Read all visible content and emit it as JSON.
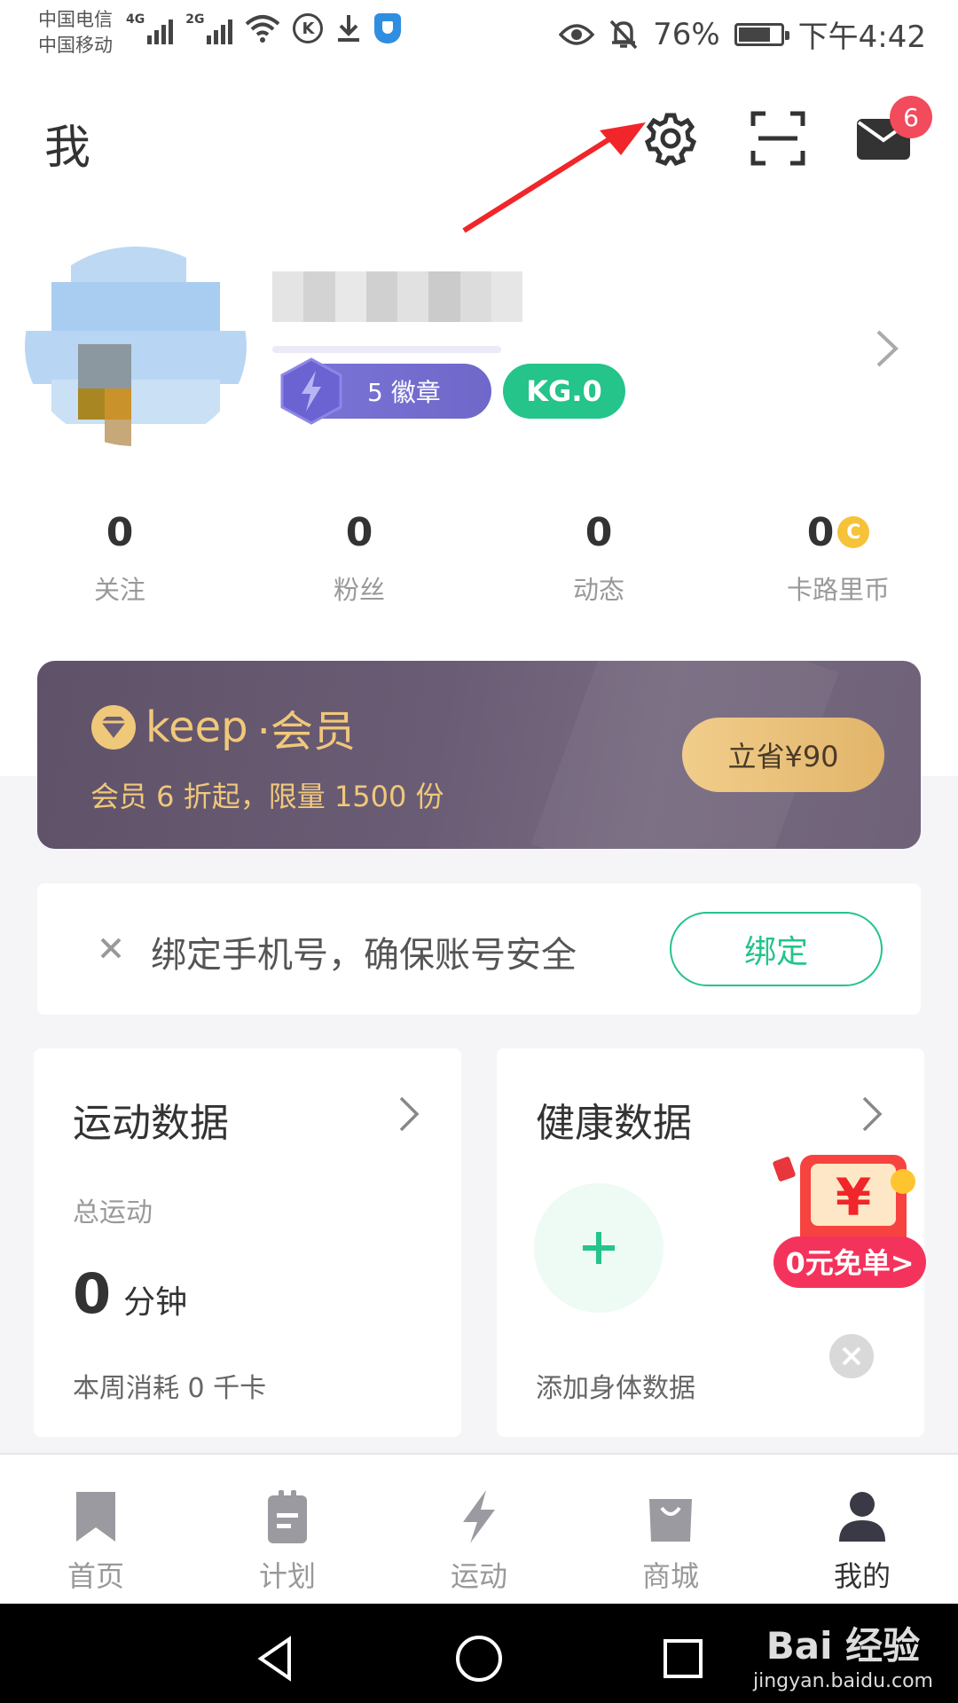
{
  "status_bar": {
    "carrier_1": "中国电信",
    "carrier_2": "中国移动",
    "net_1": "4G",
    "net_2": "2G",
    "k_icon_letter": "K",
    "battery_percent": "76%",
    "battery_level": 0.76,
    "time": "下午4:42"
  },
  "header": {
    "title": "我",
    "mail_badge_count": "6"
  },
  "profile": {
    "badge_count_label": "5 徽章",
    "kg_level": "KG.0"
  },
  "stats": [
    {
      "value": "0",
      "label": "关注"
    },
    {
      "value": "0",
      "label": "粉丝"
    },
    {
      "value": "0",
      "label": "动态"
    },
    {
      "value": "0",
      "label": "卡路里币",
      "coin_glyph": "C"
    }
  ],
  "vip_banner": {
    "brand": "keep",
    "brand_suffix": "·会员",
    "subtitle": "会员 6 折起，限量 1500 份",
    "button": "立省¥90"
  },
  "bind_card": {
    "text": "绑定手机号，确保账号安全",
    "button": "绑定"
  },
  "sport_card": {
    "title": "运动数据",
    "subtitle": "总运动",
    "minutes_value": "0",
    "minutes_unit": "分钟",
    "week_text": "本周消耗 0 千卡"
  },
  "health_card": {
    "title": "健康数据",
    "add_text": "添加身体数据"
  },
  "promo": {
    "symbol": "¥",
    "label": "0元免单>"
  },
  "tabs": [
    {
      "label": "首页",
      "icon": "bookmark-icon"
    },
    {
      "label": "计划",
      "icon": "clipboard-icon"
    },
    {
      "label": "运动",
      "icon": "lightning-icon"
    },
    {
      "label": "商城",
      "icon": "shopping-bag-icon"
    },
    {
      "label": "我的",
      "icon": "person-icon"
    }
  ],
  "watermark": {
    "line1": "Bai 经验",
    "line2": "jingyan.baidu.com"
  },
  "colors": {
    "accent_green": "#24c48a",
    "vip_gold": "#f0c87a",
    "badge_purple": "#7b75d8",
    "notification_red": "#f24b5b",
    "annotation_red": "#f0262a"
  }
}
